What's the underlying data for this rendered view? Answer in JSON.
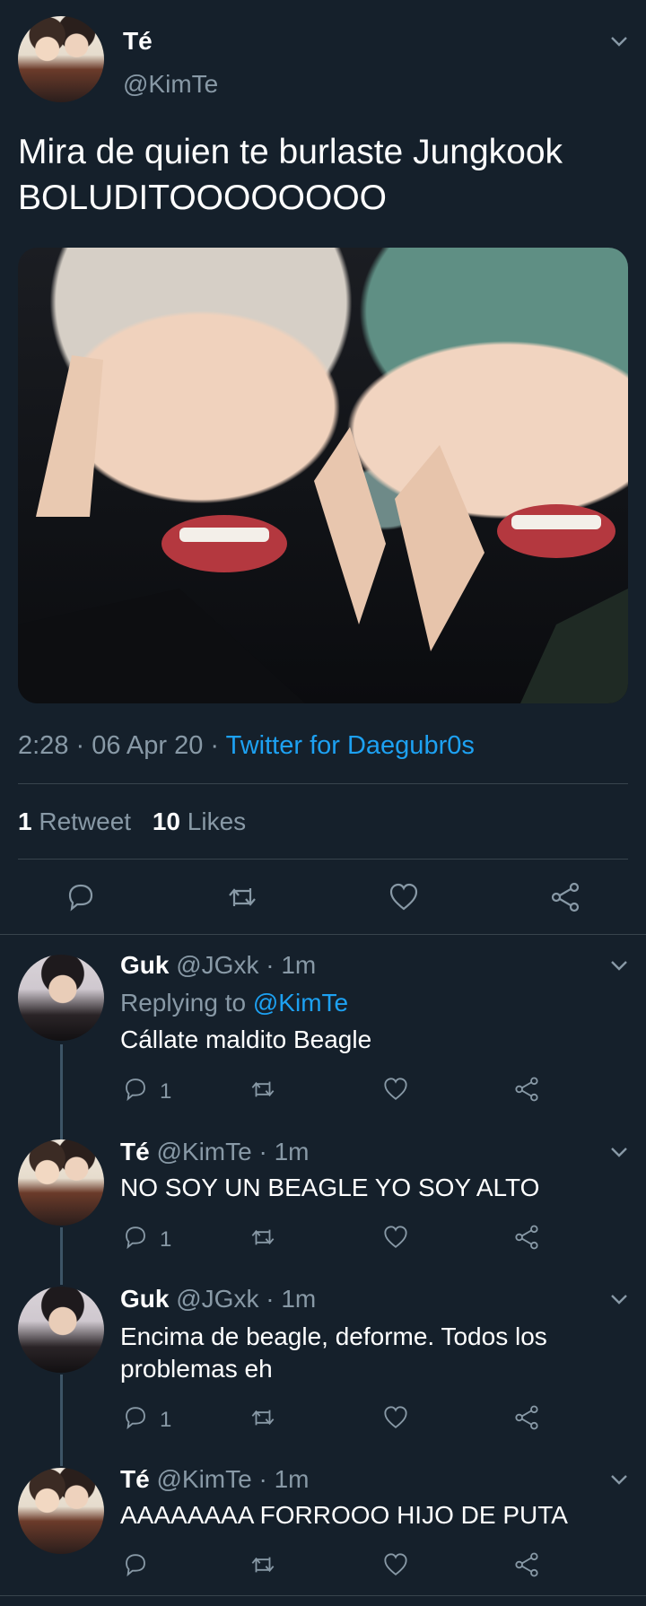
{
  "tweet": {
    "author_name": "Té",
    "author_handle": "@KimTe",
    "text_line1": "Mira de quien te burlaste Jungkook",
    "text_line2": "BOLUDITOOOOOOOO",
    "time": "2:28 · 06 Apr 20 · ",
    "source": "Twitter for Daegubr0s",
    "retweets_count": "1",
    "retweets_label": "Retweet",
    "likes_count": "10",
    "likes_label": "Likes"
  },
  "replies": [
    {
      "name": "Guk",
      "handle_time": "@JGxk · 1m",
      "replying_prefix": "Replying to",
      "replying_handle": "@KimTe",
      "text": "Cállate maldito Beagle",
      "reply_count": "1"
    },
    {
      "name": "Té",
      "handle_time": "@KimTe · 1m",
      "text": "NO SOY UN BEAGLE YO SOY ALTO",
      "reply_count": "1"
    },
    {
      "name": "Guk",
      "handle_time": "@JGxk · 1m",
      "text_line1": "Encima de beagle, deforme. Todos los",
      "text_line2": "problemas eh",
      "reply_count": "1"
    },
    {
      "name": "Té",
      "handle_time": "@KimTe · 1m",
      "text": "AAAAAAAA FORROOO HIJO DE PUTA"
    }
  ],
  "colors": {
    "background": "#15202b",
    "muted": "#8899a6",
    "link": "#1da1f2",
    "divider": "#38444d"
  },
  "icons": [
    "chevron-down-icon",
    "reply-icon",
    "retweet-icon",
    "like-icon",
    "share-icon"
  ]
}
